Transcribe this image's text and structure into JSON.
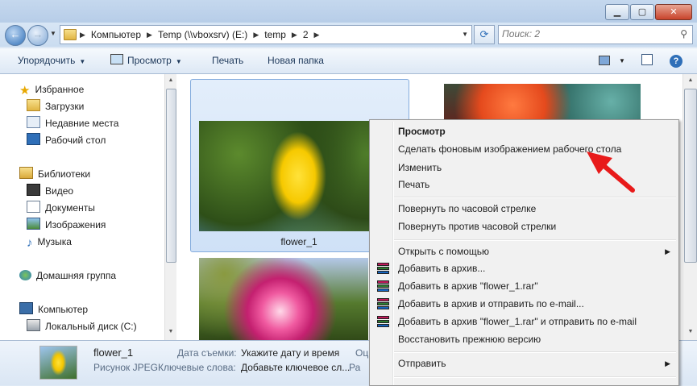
{
  "window": {
    "title_buttons": {
      "minimize": "▁",
      "maximize": "▢",
      "close": "✕"
    }
  },
  "address": {
    "crumbs": [
      "Компьютер",
      "Temp (\\\\vboxsrv) (E:)",
      "temp",
      "2"
    ],
    "search_placeholder": "Поиск: 2"
  },
  "toolbar": {
    "organize": "Упорядочить",
    "preview": "Просмотр",
    "print": "Печать",
    "new_folder": "Новая папка"
  },
  "nav": {
    "favorites": "Избранное",
    "downloads": "Загрузки",
    "recent": "Недавние места",
    "desktop": "Рабочий стол",
    "libraries": "Библиотеки",
    "video": "Видео",
    "documents": "Документы",
    "images": "Изображения",
    "music": "Музыка",
    "homegroup": "Домашняя группа",
    "computer": "Компьютер",
    "local_disk": "Локальный диск (C:)"
  },
  "files": {
    "selected_name": "flower_1"
  },
  "details": {
    "name": "flower_1",
    "type": "Рисунок JPEG",
    "date_label": "Дата съемки:",
    "date_value": "Укажите дату и время",
    "keywords_label": "Ключевые слова:",
    "keywords_value": "Добавьте ключевое сл...",
    "cut_label_1": "Оц",
    "cut_label_2": "Ра"
  },
  "context_menu": {
    "preview": "Просмотр",
    "set_wallpaper": "Сделать фоновым изображением рабочего стола",
    "edit": "Изменить",
    "print": "Печать",
    "rotate_cw": "Повернуть по часовой стрелке",
    "rotate_ccw": "Повернуть против часовой стрелки",
    "open_with": "Открыть с помощью",
    "add_archive": "Добавить в архив...",
    "add_rar": "Добавить в архив \"flower_1.rar\"",
    "add_email": "Добавить в архив и отправить по e-mail...",
    "add_rar_email": "Добавить в архив \"flower_1.rar\" и отправить по e-mail",
    "restore": "Восстановить прежнюю версию",
    "send_to": "Отправить"
  },
  "colors": {
    "annotation_arrow": "#e81a1a",
    "selection": "#cfe1f7"
  }
}
